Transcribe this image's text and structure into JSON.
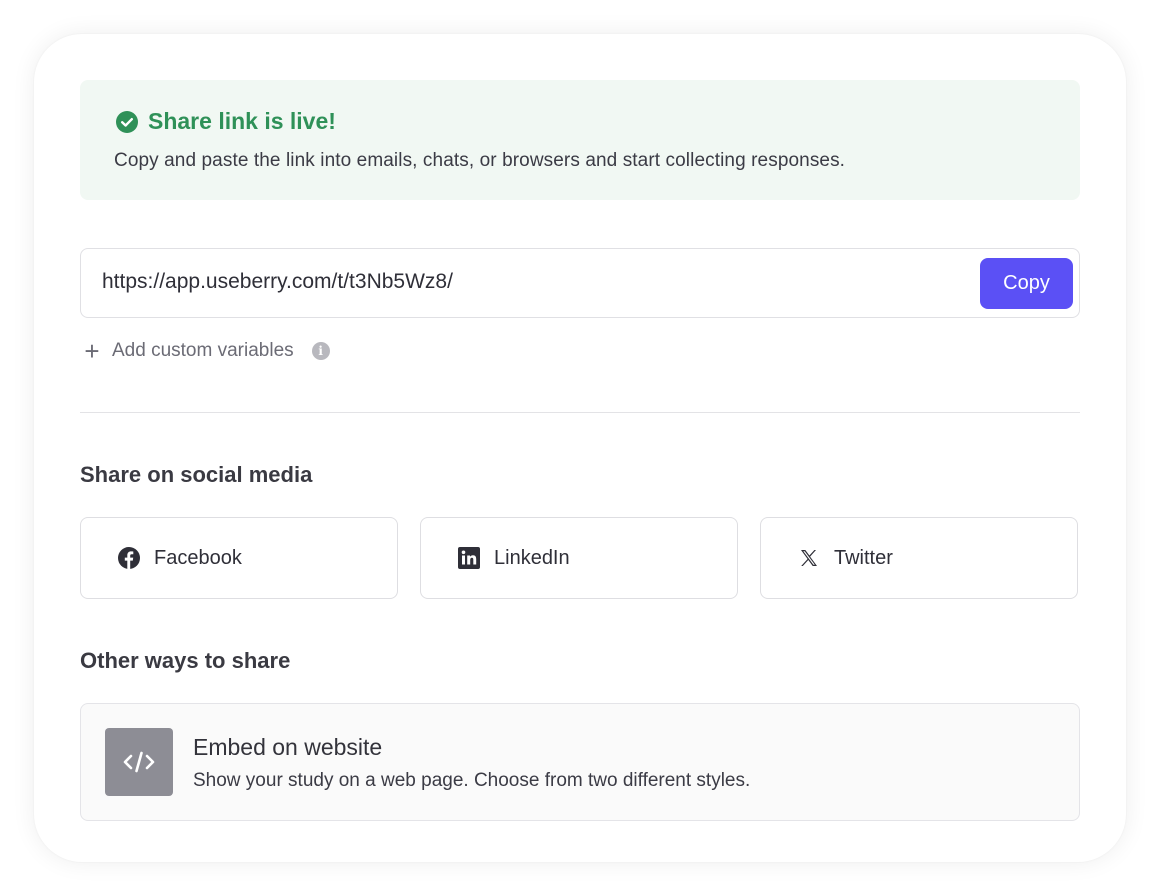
{
  "alert": {
    "title": "Share link is live!",
    "description": "Copy and paste the link into emails, chats, or browsers and start collecting responses.",
    "icon": "check-circle-icon",
    "color": "#2f9158",
    "background": "#f1f8f3"
  },
  "share_link": {
    "url": "https://app.useberry.com/t/t3Nb5Wz8/",
    "copy_label": "Copy",
    "accent": "#5b50f5"
  },
  "custom_variables": {
    "label": "Add custom variables",
    "icon": "plus-icon",
    "info_icon": "info-icon"
  },
  "social": {
    "title": "Share on social media",
    "buttons": [
      {
        "label": "Facebook",
        "icon": "facebook-icon"
      },
      {
        "label": "LinkedIn",
        "icon": "linkedin-icon"
      },
      {
        "label": "Twitter",
        "icon": "x-twitter-icon"
      }
    ]
  },
  "other": {
    "title": "Other ways to share",
    "embed": {
      "title": "Embed on website",
      "description": "Show your study on a web page. Choose from two different styles.",
      "icon": "code-icon"
    }
  }
}
